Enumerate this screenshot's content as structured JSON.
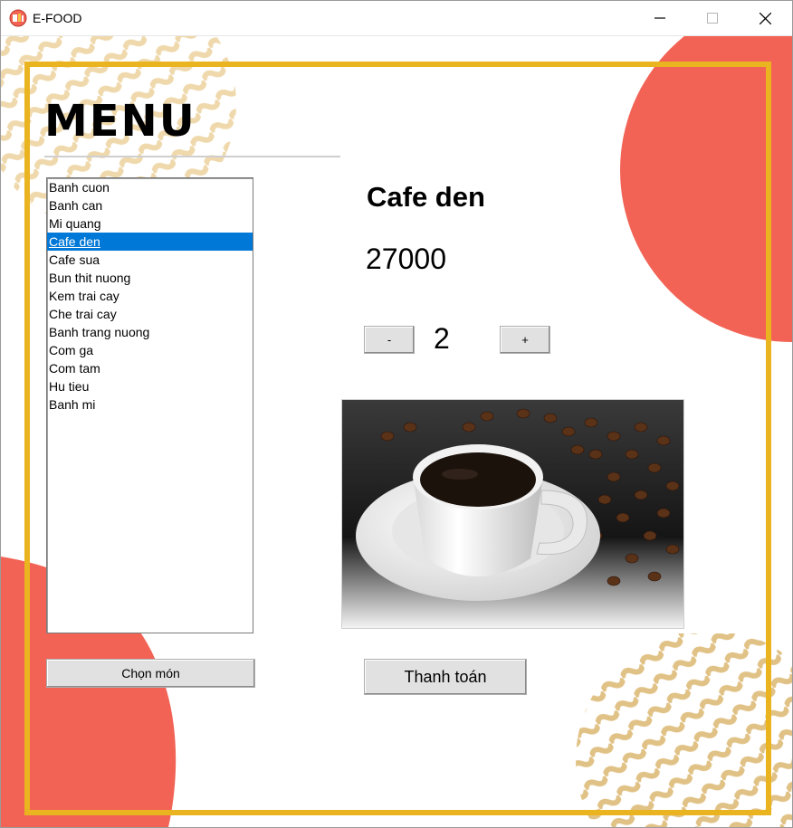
{
  "window": {
    "title": "E-FOOD",
    "controls": [
      "minimize-icon",
      "maximize-icon",
      "close-icon"
    ]
  },
  "colors": {
    "frame": "#eab320",
    "blob": "#f26355",
    "waves": "#e7c78b",
    "selection": "#0078d7"
  },
  "menu": {
    "title": "MENU",
    "items": [
      "Banh cuon",
      "Banh can",
      "Mi quang",
      "Cafe den",
      "Cafe sua",
      "Bun thit nuong",
      "Kem trai cay",
      "Che trai cay",
      "Banh trang nuong",
      "Com ga",
      "Com tam",
      "Hu tieu",
      "Banh mi"
    ],
    "selected_index": 3,
    "choose_label": "Chọn món"
  },
  "detail": {
    "name": "Cafe den",
    "price": "27000",
    "decrement_label": "-",
    "increment_label": "+",
    "quantity": "2",
    "image_alt": "coffee-cup-image",
    "checkout_label": "Thanh toán"
  }
}
